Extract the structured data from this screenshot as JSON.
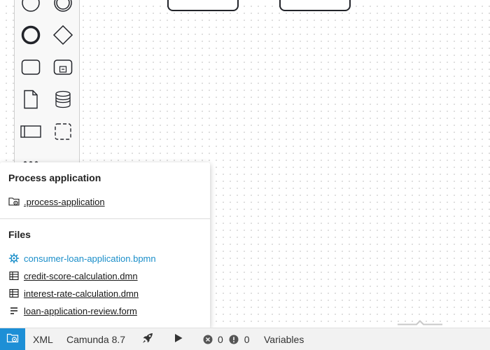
{
  "popup": {
    "process_section_title": "Process application",
    "process_item": {
      "label": ".process-application",
      "icon": "folder-gear-icon"
    },
    "files_section_title": "Files",
    "files": [
      {
        "label": "consumer-loan-application.bpmn",
        "icon": "gear-icon",
        "active": true
      },
      {
        "label": "credit-score-calculation.dmn",
        "icon": "table-icon",
        "active": false
      },
      {
        "label": "interest-rate-calculation.dmn",
        "icon": "table-icon",
        "active": false
      },
      {
        "label": "loan-application-review.form",
        "icon": "form-icon",
        "active": false
      }
    ]
  },
  "statusbar": {
    "app_button_icon": "process-application-icon",
    "xml_label": "XML",
    "engine_label": "Camunda 8.7",
    "deploy_icon": "rocket-icon",
    "run_icon": "play-icon",
    "error_count": "0",
    "warning_count": "0",
    "variables_label": "Variables"
  },
  "colors": {
    "accent": "#1d8fd6",
    "active_link": "#1a8ec9",
    "statusbar_bg": "#f2f2f2"
  },
  "palette_tools": [
    "start-event-icon",
    "intermediate-event-icon",
    "end-event-icon",
    "gateway-icon",
    "task-icon",
    "subprocess-icon",
    "data-object-icon",
    "data-store-icon",
    "pool-icon",
    "group-icon",
    "more-tools-icon"
  ]
}
